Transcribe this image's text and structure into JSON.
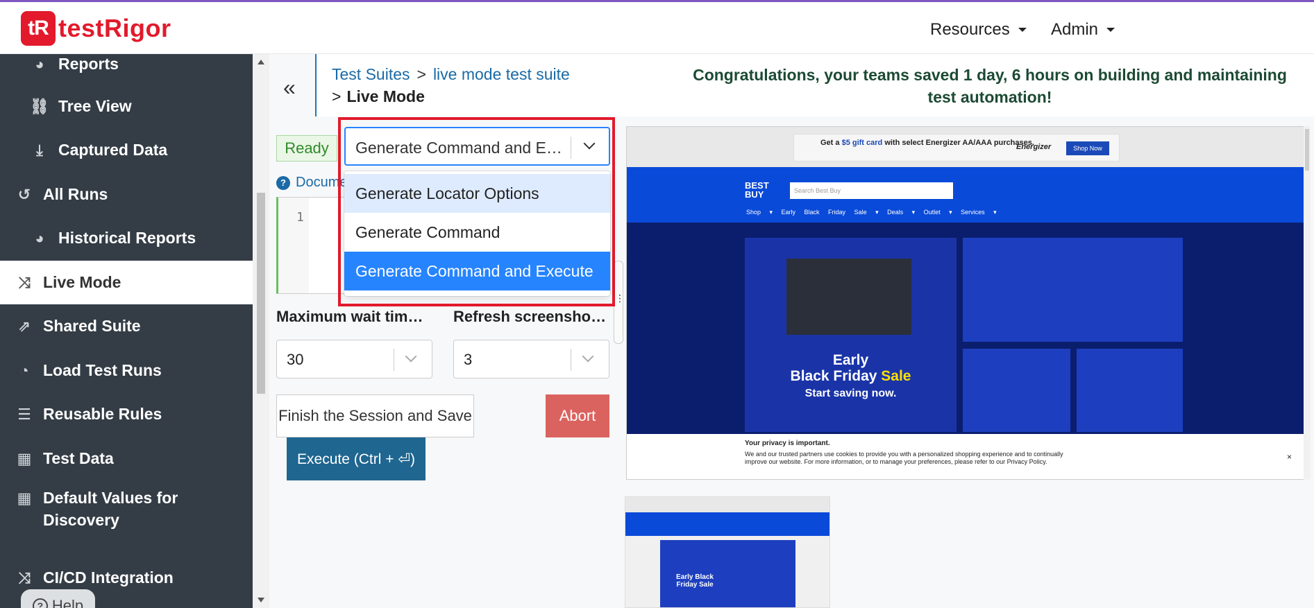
{
  "app": {
    "logo_mark": "tR",
    "logo_text": "testRigor",
    "brand_color": "#e21a2c"
  },
  "header": {
    "resources": "Resources",
    "admin": "Admin"
  },
  "sidebar": {
    "items": [
      {
        "label": "Reports",
        "icon": "pie-chart-icon"
      },
      {
        "label": "Tree View",
        "icon": "tree-icon"
      },
      {
        "label": "Captured Data",
        "icon": "download-icon"
      },
      {
        "label": "All Runs",
        "icon": "history-icon"
      },
      {
        "label": "Historical Reports",
        "icon": "pie-chart-icon"
      },
      {
        "label": "Live Mode",
        "icon": "shuffle-icon"
      },
      {
        "label": "Shared Suite",
        "icon": "share-icon"
      },
      {
        "label": "Load Test Runs",
        "icon": "gauge-icon"
      },
      {
        "label": "Reusable Rules",
        "icon": "list-icon"
      },
      {
        "label": "Test Data",
        "icon": "table-icon"
      },
      {
        "label": "Default Values for Discovery",
        "icon": "table-icon"
      },
      {
        "label": "CI/CD Integration",
        "icon": "shuffle-icon"
      }
    ],
    "help_label": "Help"
  },
  "breadcrumb": {
    "root": "Test Suites",
    "sep": ">",
    "suite": "live mode test suite",
    "current": "Live Mode"
  },
  "congrats": "Congratulations, your teams saved 1 day, 6 hours on building and maintaining test automation!",
  "status": "Ready",
  "doc_link": "Docume",
  "editor": {
    "line": "1"
  },
  "mode_select": {
    "value": "Generate Command and Execute",
    "options": [
      "Generate Locator Options",
      "Generate Command",
      "Generate Command and Execute"
    ]
  },
  "wait": {
    "label": "Maximum wait time in seconds",
    "value": "30"
  },
  "refresh": {
    "label": "Refresh screenshot interval",
    "value": "3"
  },
  "buttons": {
    "finish": "Finish the Session and Save",
    "abort": "Abort",
    "execute": "Execute (Ctrl + ⏎)"
  },
  "screenshot": {
    "promo_prefix": "Get a ",
    "promo_gift": "$5 gift card",
    "promo_suffix": " with select Energizer AA/AAA purchases.",
    "promo_brand": "Energizer",
    "promo_btn": "Shop Now",
    "logo": "BEST BUY",
    "search_placeholder": "Search Best Buy",
    "menu": "Shop ▾ Early Black Friday Sale ▾ Deals ▾ Outlet ▾ Services ▾",
    "hero_line1": "Early",
    "hero_line2a": "Black Friday ",
    "hero_line2b": "Sale",
    "hero_line3": "Start saving now.",
    "privacy_title": "Your privacy is important.",
    "privacy_body": "We and our trusted partners use cookies to provide you with a personalized shopping experience and to continually improve our website. For more information, or to manage your preferences, please refer to our Privacy Policy.",
    "privacy_close": "×"
  },
  "thumb": {
    "text": "Early Black Friday Sale"
  }
}
